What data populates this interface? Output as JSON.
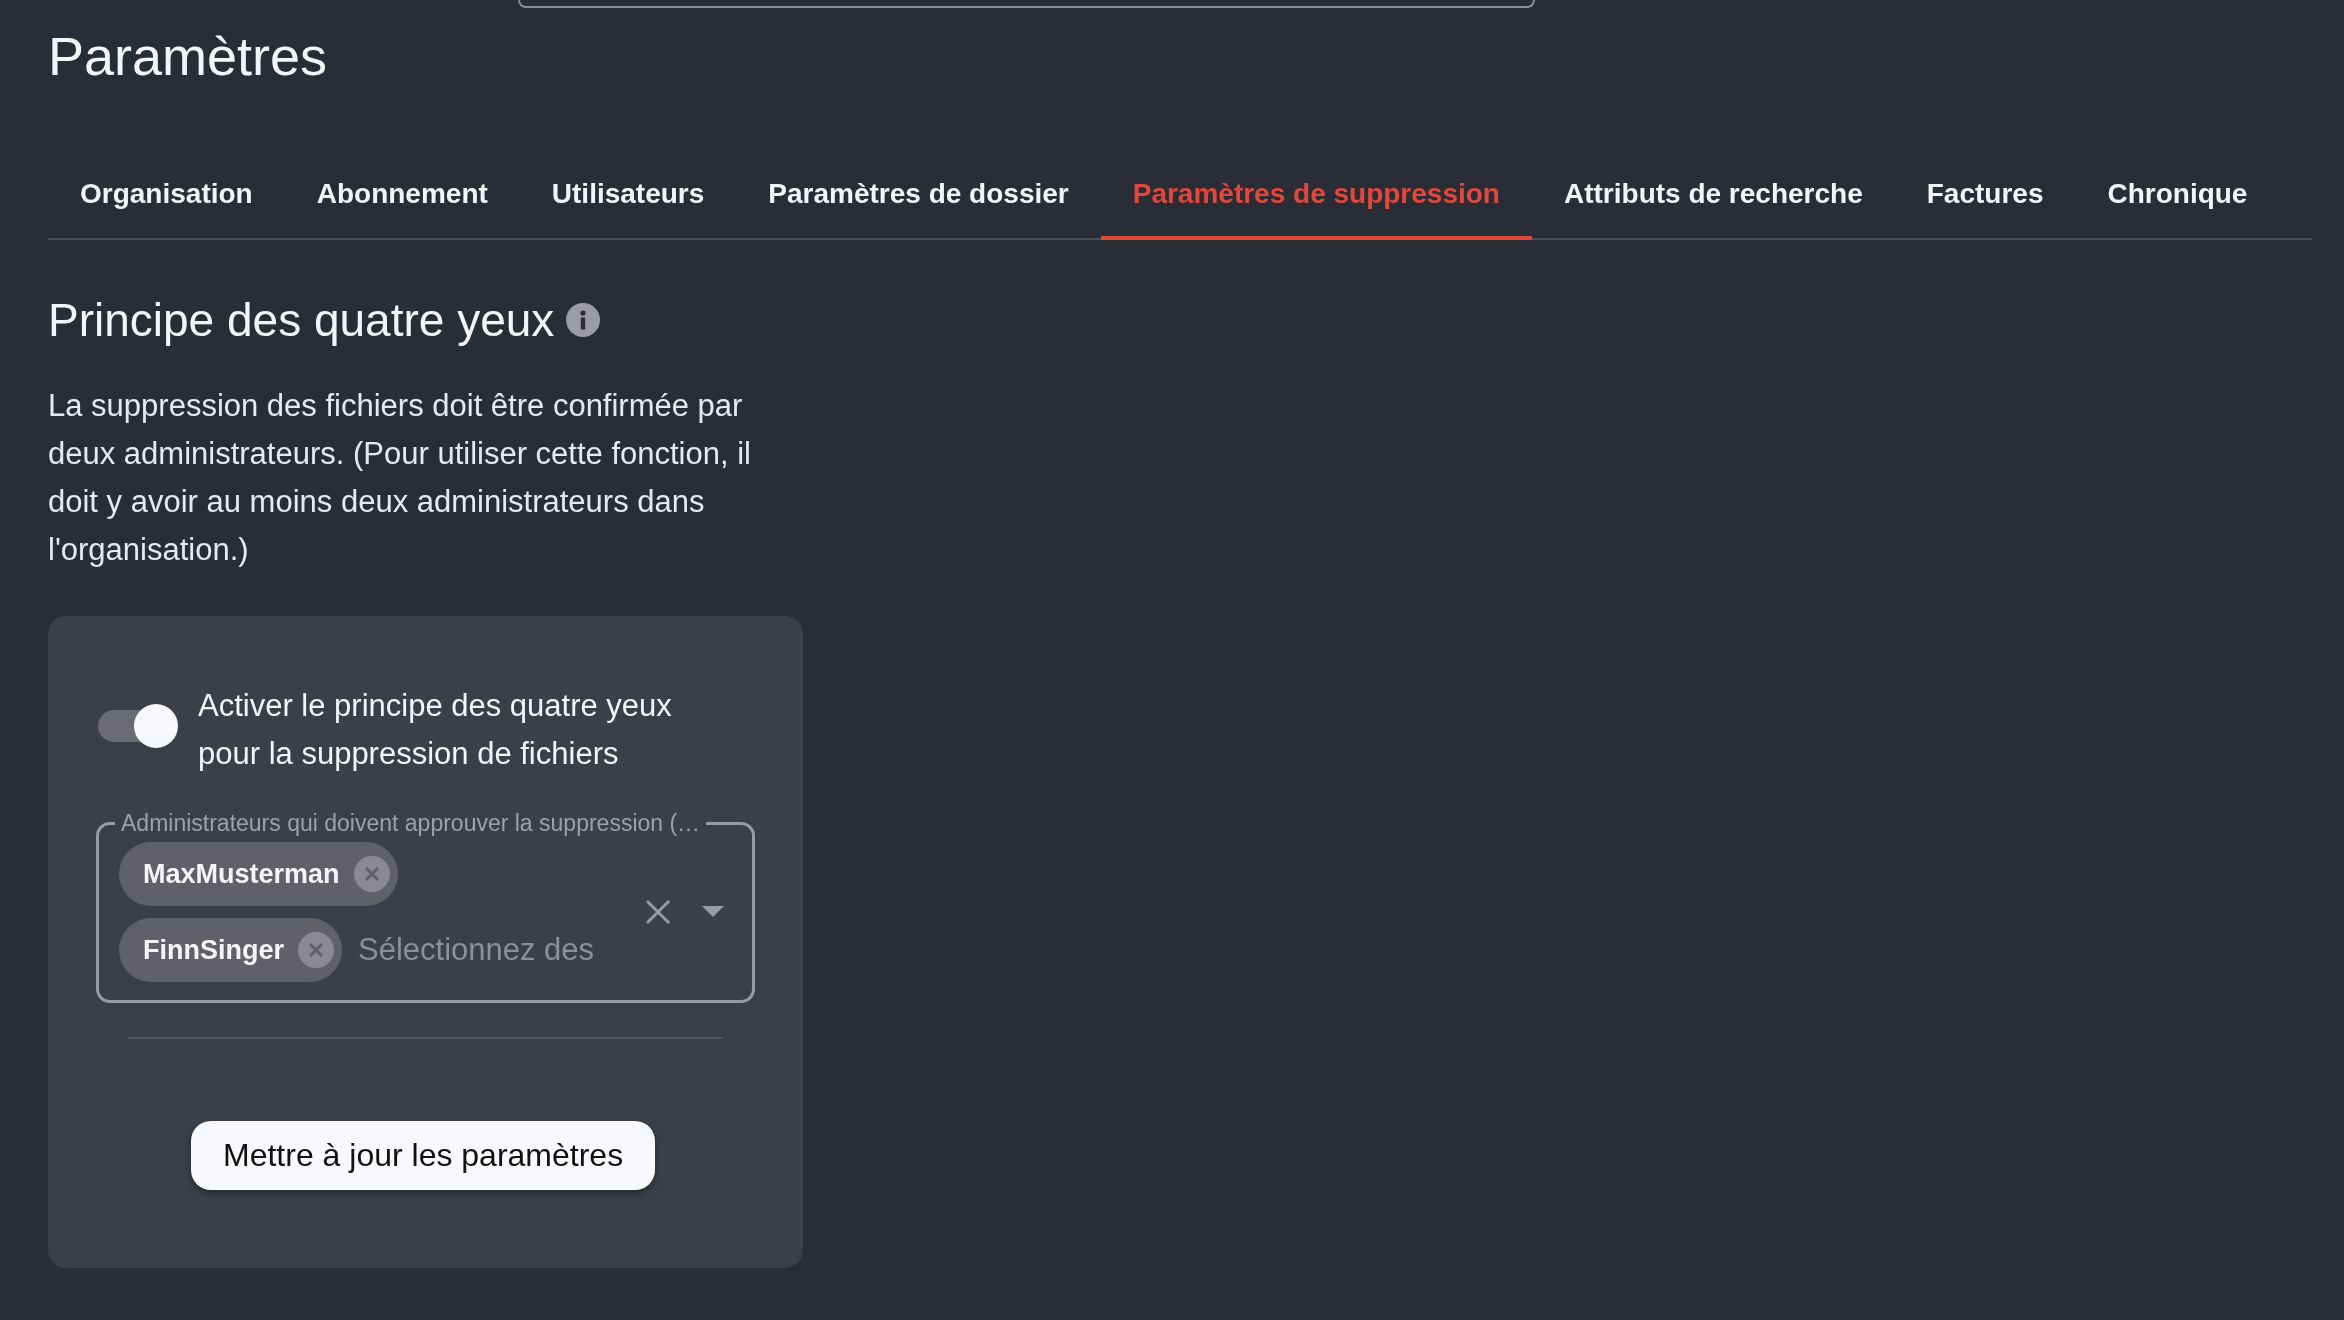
{
  "page": {
    "title": "Paramètres"
  },
  "tabs": [
    {
      "label": "Organisation",
      "selected": false
    },
    {
      "label": "Abonnement",
      "selected": false
    },
    {
      "label": "Utilisateurs",
      "selected": false
    },
    {
      "label": "Paramètres de dossier",
      "selected": false
    },
    {
      "label": "Paramètres de suppression",
      "selected": true
    },
    {
      "label": "Attributs de recherche",
      "selected": false
    },
    {
      "label": "Factures",
      "selected": false
    },
    {
      "label": "Chronique",
      "selected": false
    }
  ],
  "section": {
    "title": "Principe des quatre yeux",
    "description": "La suppression des fichiers doit être confirmée par deux administrateurs. (Pour utiliser cette fonction, il doit y avoir au moins deux administrateurs dans l'organisation.)"
  },
  "settings_card": {
    "toggle": {
      "label": "Activer le principe des quatre yeux pour la suppression de fichiers",
      "on": true
    },
    "approvers_field": {
      "label": "Administrateurs qui doivent approuver la suppression (…",
      "placeholder": "Sélectionnez des",
      "chips": [
        {
          "label": "MaxMusterman"
        },
        {
          "label": "FinnSinger"
        }
      ]
    },
    "submit_button": "Mettre à jour les paramètres"
  }
}
